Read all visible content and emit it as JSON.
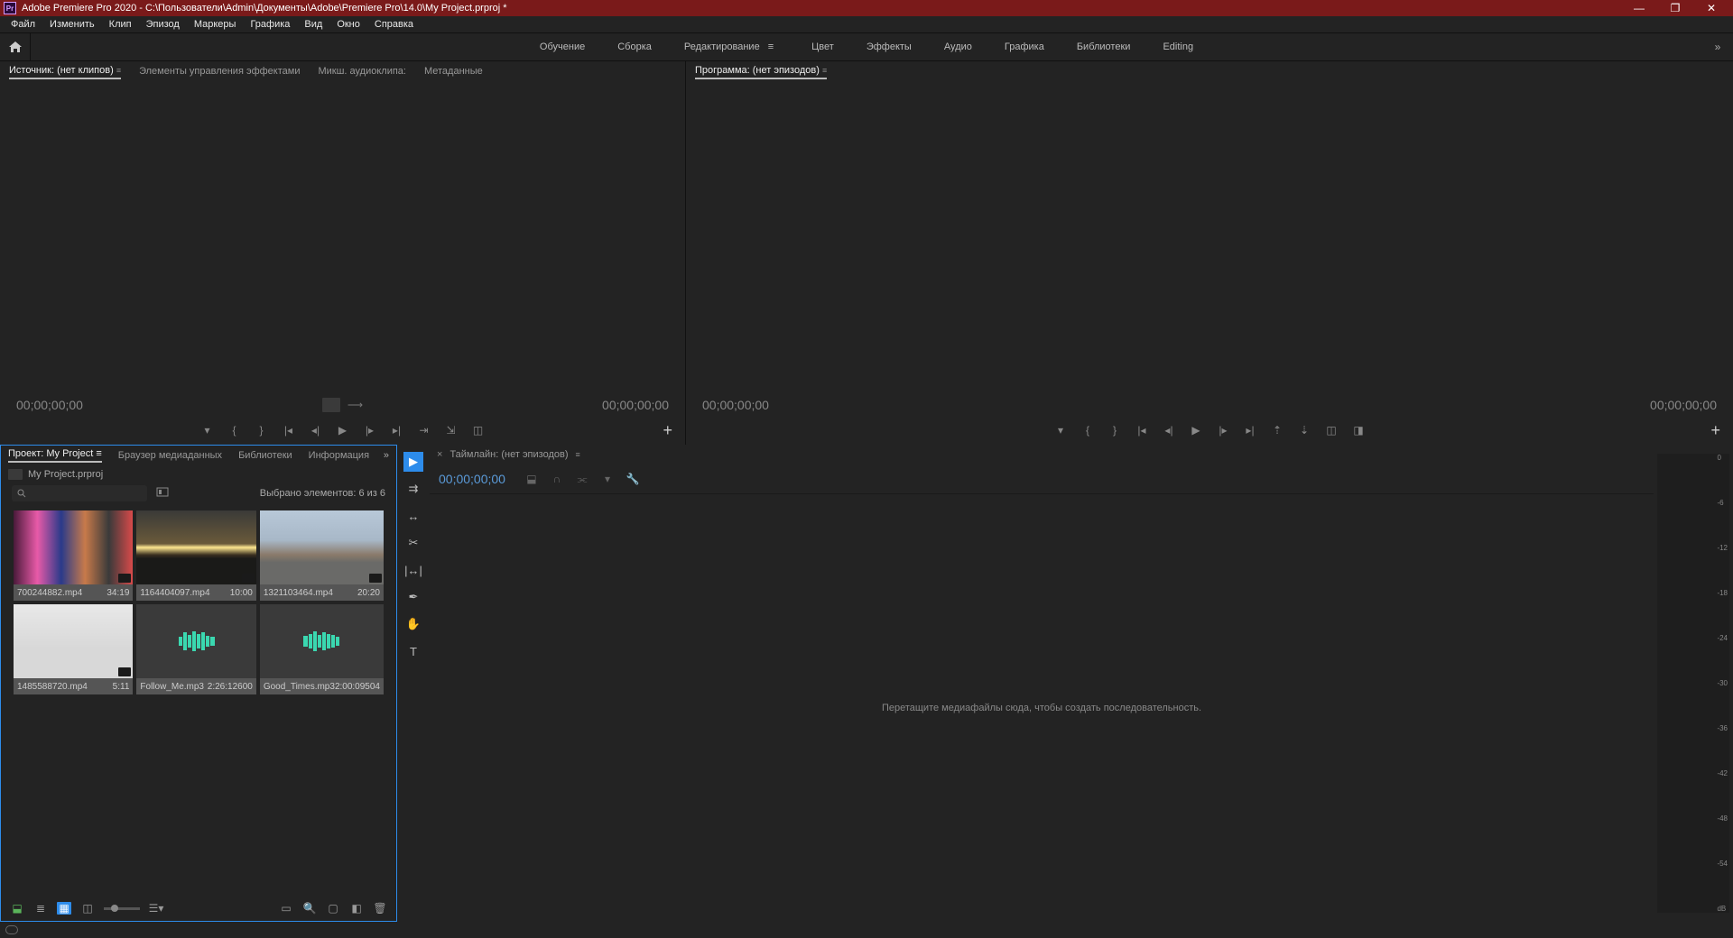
{
  "titlebar": {
    "app": "Adobe Premiere Pro 2020",
    "path": "C:\\Пользователи\\Admin\\Документы\\Adobe\\Premiere Pro\\14.0\\My Project.prproj *",
    "logo": "Pr"
  },
  "menu": [
    "Файл",
    "Изменить",
    "Клип",
    "Эпизод",
    "Маркеры",
    "Графика",
    "Вид",
    "Окно",
    "Справка"
  ],
  "workspaces": {
    "items": [
      "Обучение",
      "Сборка",
      "Редактирование",
      "Цвет",
      "Эффекты",
      "Аудио",
      "Графика",
      "Библиотеки",
      "Editing"
    ],
    "activeIndex": 2
  },
  "sourcePanel": {
    "tabs": [
      "Источник: (нет клипов)",
      "Элементы управления эффектами",
      "Микш. аудиоклипа:",
      "Метаданные"
    ],
    "activeIndex": 0,
    "tcLeft": "00;00;00;00",
    "tcRight": "00;00;00;00"
  },
  "programPanel": {
    "tab": "Программа: (нет эпизодов)",
    "tcLeft": "00;00;00;00",
    "tcRight": "00;00;00;00"
  },
  "projectPanel": {
    "tabs": [
      "Проект: My Project",
      "Браузер медиаданных",
      "Библиотеки",
      "Информация"
    ],
    "activeIndex": 0,
    "breadcrumb": "My Project.prproj",
    "selectionInfo": "Выбрано элементов: 6 из 6",
    "clips": [
      {
        "name": "700244882.mp4",
        "dur": "34:19",
        "type": "video1"
      },
      {
        "name": "1164404097.mp4",
        "dur": "10:00",
        "type": "video2"
      },
      {
        "name": "1321103464.mp4",
        "dur": "20:20",
        "type": "video3"
      },
      {
        "name": "1485588720.mp4",
        "dur": "5:11",
        "type": "video4"
      },
      {
        "name": "Follow_Me.mp3",
        "dur": "2:26:12600",
        "type": "audio"
      },
      {
        "name": "Good_Times.mp3",
        "dur": "2:00:09504",
        "type": "audio"
      }
    ]
  },
  "timelinePanel": {
    "tab": "Таймлайн: (нет эпизодов)",
    "tc": "00;00;00;00",
    "placeholder": "Перетащите медиафайлы сюда, чтобы создать последовательность."
  },
  "audioMeter": {
    "ticks": [
      "0",
      "-6",
      "-12",
      "-18",
      "-24",
      "-30",
      "-36",
      "-42",
      "-48",
      "-54",
      "dB"
    ]
  }
}
